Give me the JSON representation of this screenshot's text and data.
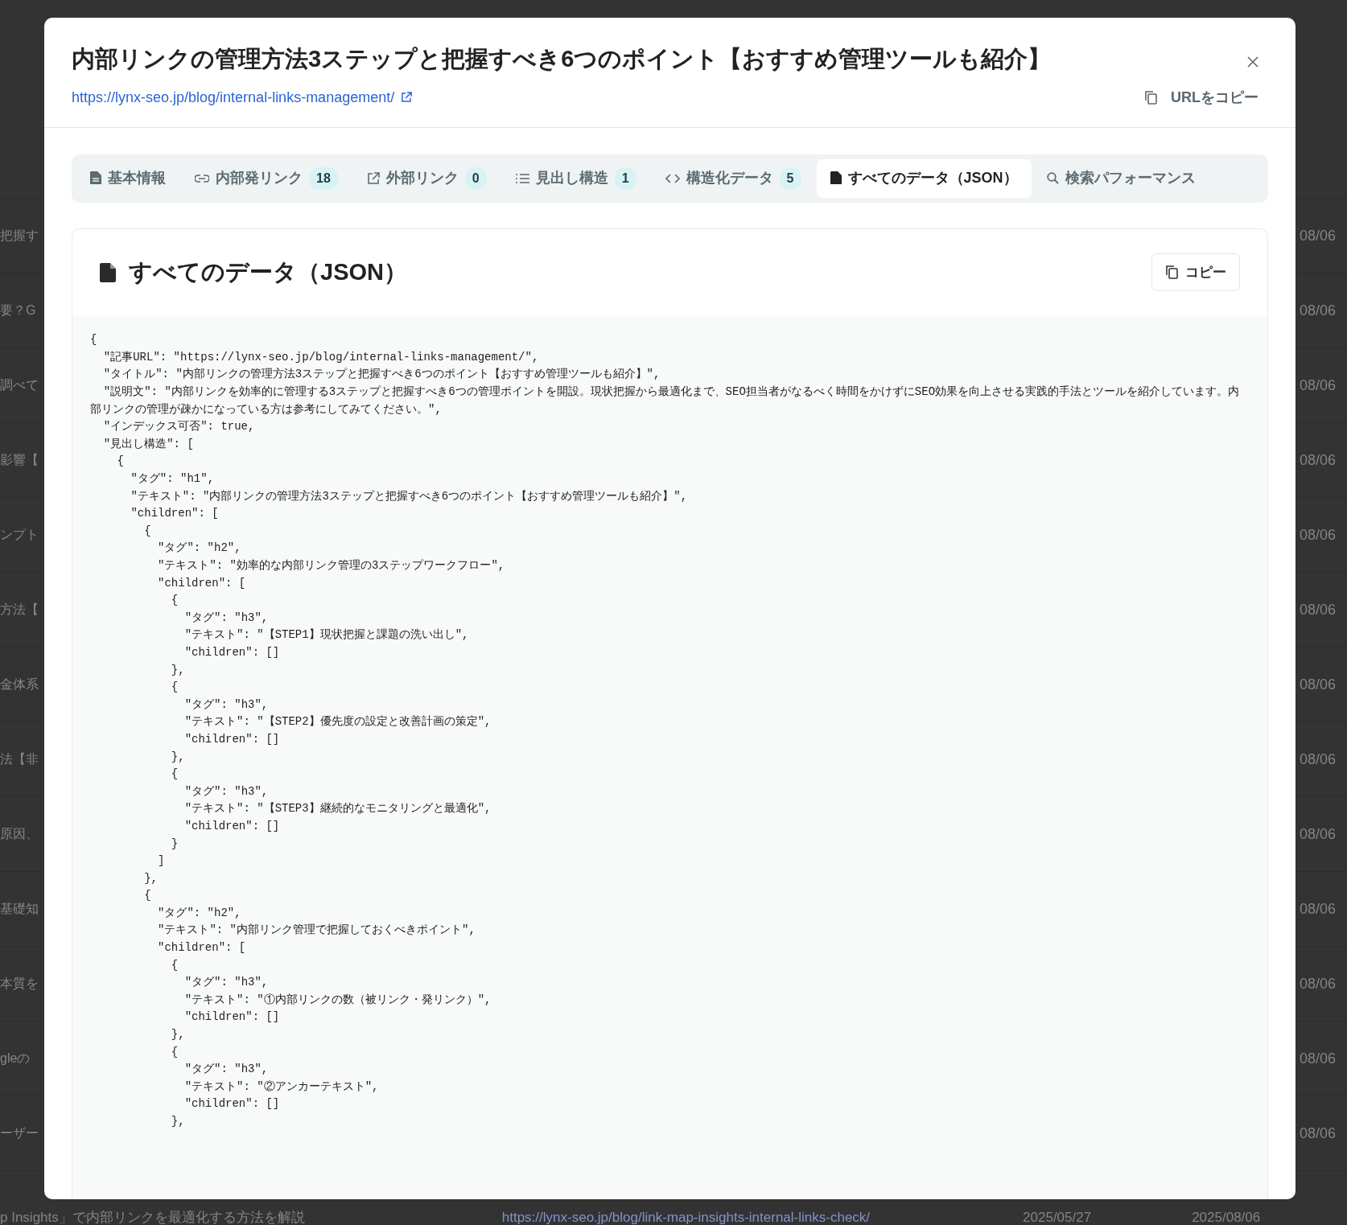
{
  "background": {
    "rows": [
      {
        "title_fragment": "把握す",
        "date_fragment": "08/06"
      },
      {
        "title_fragment": "要？G",
        "date_fragment": "08/06"
      },
      {
        "title_fragment": "調べて",
        "date_fragment": "08/06"
      },
      {
        "title_fragment": "影響【",
        "date_fragment": "08/06"
      },
      {
        "title_fragment": "ンプト",
        "date_fragment": "08/06"
      },
      {
        "title_fragment": "方法【",
        "date_fragment": "08/06"
      },
      {
        "title_fragment": "金体系",
        "date_fragment": "08/06"
      },
      {
        "title_fragment": "法【非",
        "date_fragment": "08/06"
      },
      {
        "title_fragment": "原因、",
        "date_fragment": "08/06"
      },
      {
        "title_fragment": "基礎知",
        "date_fragment": "08/06"
      },
      {
        "title_fragment": "本質を",
        "date_fragment": "08/06"
      },
      {
        "title_fragment": "gleの",
        "date_fragment": "08/06"
      },
      {
        "title_fragment": "ーザー",
        "date_fragment": "08/06"
      }
    ],
    "last_row": {
      "title": "p Insights」で内部リンクを最適化する方法を解説",
      "url": "https://lynx-seo.jp/blog/link-map-insights-internal-links-check/",
      "published": "2025/05/27",
      "updated": "2025/08/06"
    }
  },
  "modal": {
    "title": "内部リンクの管理方法3ステップと把握すべき6つのポイント【おすすめ管理ツールも紹介】",
    "url": "https://lynx-seo.jp/blog/internal-links-management/",
    "copy_url_label": "URLをコピー",
    "tabs": [
      {
        "label": "基本情報",
        "selected": false
      },
      {
        "label": "内部発リンク",
        "badge": "18",
        "selected": false
      },
      {
        "label": "外部リンク",
        "badge": "0",
        "selected": false
      },
      {
        "label": "見出し構造",
        "badge": "1",
        "selected": false
      },
      {
        "label": "構造化データ",
        "badge": "5",
        "selected": false
      },
      {
        "label": "すべてのデータ（JSON）",
        "selected": true
      },
      {
        "label": "検索パフォーマンス",
        "selected": false
      }
    ],
    "panel": {
      "title": "すべてのデータ（JSON）",
      "copy_label": "コピー",
      "code_lines": [
        "{",
        "  \"記事URL\": \"https://lynx-seo.jp/blog/internal-links-management/\",",
        "  \"タイトル\": \"内部リンクの管理方法3ステップと把握すべき6つのポイント【おすすめ管理ツールも紹介】\",",
        "  \"説明文\": \"内部リンクを効率的に管理する3ステップと把握すべき6つの管理ポイントを開設。現状把握から最適化まで、SEO担当者がなるべく時間をかけずにSEO効果を向上させる実践的手法とツールを紹介しています。内部リンクの管理が疎かになっている方は参考にしてみてください。\",",
        "  \"インデックス可否\": true,",
        "  \"見出し構造\": [",
        "    {",
        "      \"タグ\": \"h1\",",
        "      \"テキスト\": \"内部リンクの管理方法3ステップと把握すべき6つのポイント【おすすめ管理ツールも紹介】\",",
        "      \"children\": [",
        "        {",
        "          \"タグ\": \"h2\",",
        "          \"テキスト\": \"効率的な内部リンク管理の3ステップワークフロー\",",
        "          \"children\": [",
        "            {",
        "              \"タグ\": \"h3\",",
        "              \"テキスト\": \"【STEP1】現状把握と課題の洗い出し\",",
        "              \"children\": []",
        "            },",
        "            {",
        "              \"タグ\": \"h3\",",
        "              \"テキスト\": \"【STEP2】優先度の設定と改善計画の策定\",",
        "              \"children\": []",
        "            },",
        "            {",
        "              \"タグ\": \"h3\",",
        "              \"テキスト\": \"【STEP3】継続的なモニタリングと最適化\",",
        "              \"children\": []",
        "            }",
        "          ]",
        "        },",
        "        {",
        "          \"タグ\": \"h2\",",
        "          \"テキスト\": \"内部リンク管理で把握しておくべきポイント\",",
        "          \"children\": [",
        "            {",
        "              \"タグ\": \"h3\",",
        "              \"テキスト\": \"①内部リンクの数（被リンク・発リンク）\",",
        "              \"children\": []",
        "            },",
        "            {",
        "              \"タグ\": \"h3\",",
        "              \"テキスト\": \"②アンカーテキスト\",",
        "              \"children\": []",
        "            },"
      ]
    }
  }
}
